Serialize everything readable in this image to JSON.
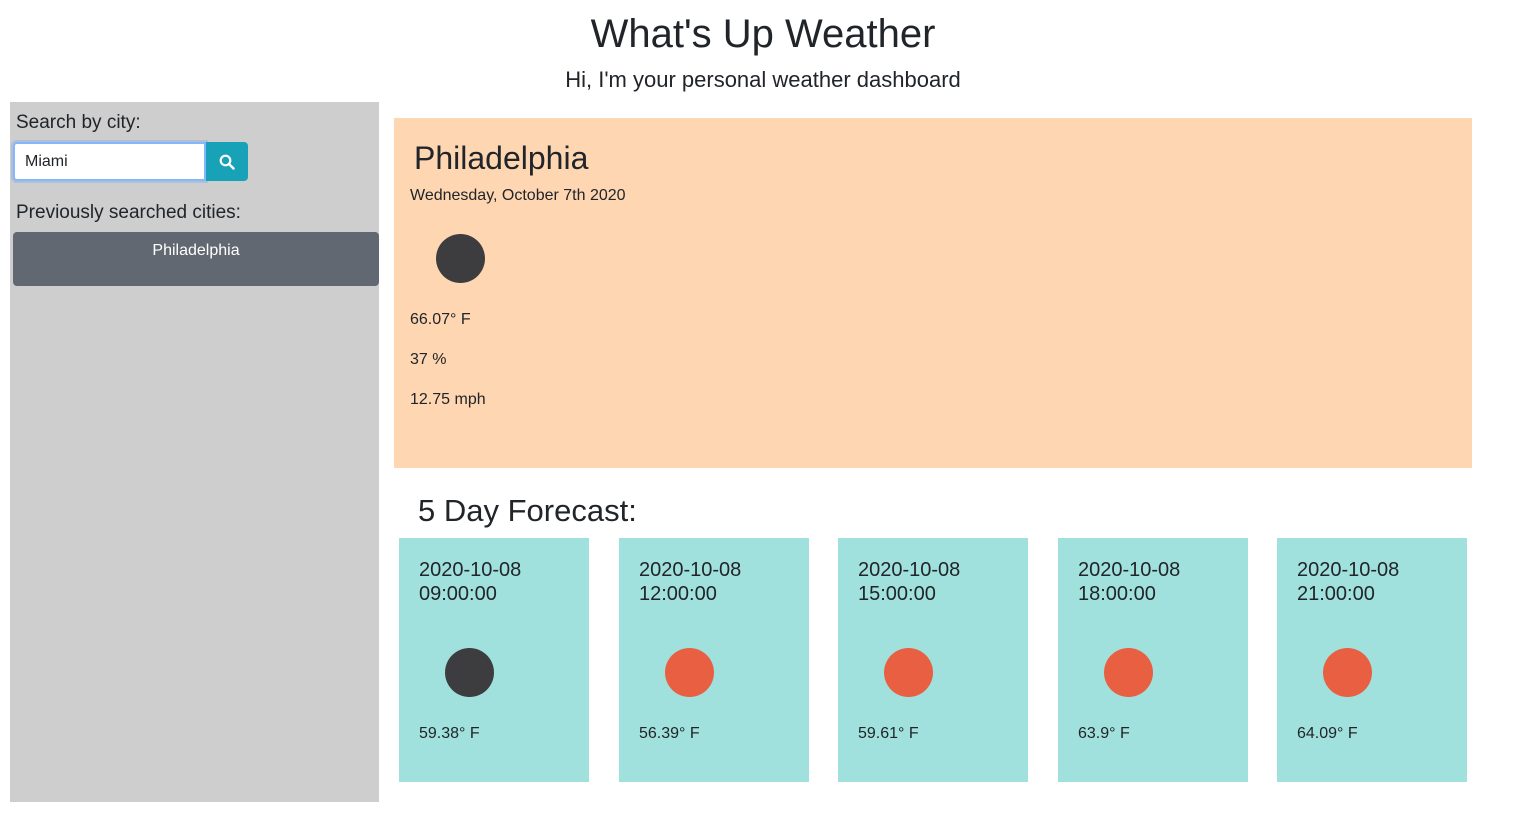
{
  "header": {
    "title": "What's Up Weather",
    "subtitle": "Hi, I'm your personal weather dashboard"
  },
  "sidebar": {
    "search_label": "Search by city:",
    "search_value": "Miami",
    "search_icon": "search-icon",
    "history_label": "Previously searched cities:",
    "history": [
      "Philadelphia"
    ]
  },
  "current": {
    "city": "Philadelphia",
    "date": "Wednesday, October 7th 2020",
    "icon_color": "#3d3d3f",
    "temp": "66.07° F",
    "humidity": "37 %",
    "wind": "12.75 mph"
  },
  "forecast": {
    "title": "5 Day Forecast:",
    "days": [
      {
        "date": "2020-10-08 09:00:00",
        "temp": "59.38° F",
        "icon_color": "#3d3d3f"
      },
      {
        "date": "2020-10-08 12:00:00",
        "temp": "56.39° F",
        "icon_color": "#e95f42"
      },
      {
        "date": "2020-10-08 15:00:00",
        "temp": "59.61° F",
        "icon_color": "#e95f42"
      },
      {
        "date": "2020-10-08 18:00:00",
        "temp": "63.9° F",
        "icon_color": "#e95f42"
      },
      {
        "date": "2020-10-08 21:00:00",
        "temp": "64.09° F",
        "icon_color": "#e95f42"
      }
    ]
  },
  "colors": {
    "sidebar_bg": "#cecece",
    "current_bg": "#fed6b2",
    "forecast_bg": "#a1e1dd",
    "search_button": "#17a2b8",
    "history_button": "#616871"
  }
}
